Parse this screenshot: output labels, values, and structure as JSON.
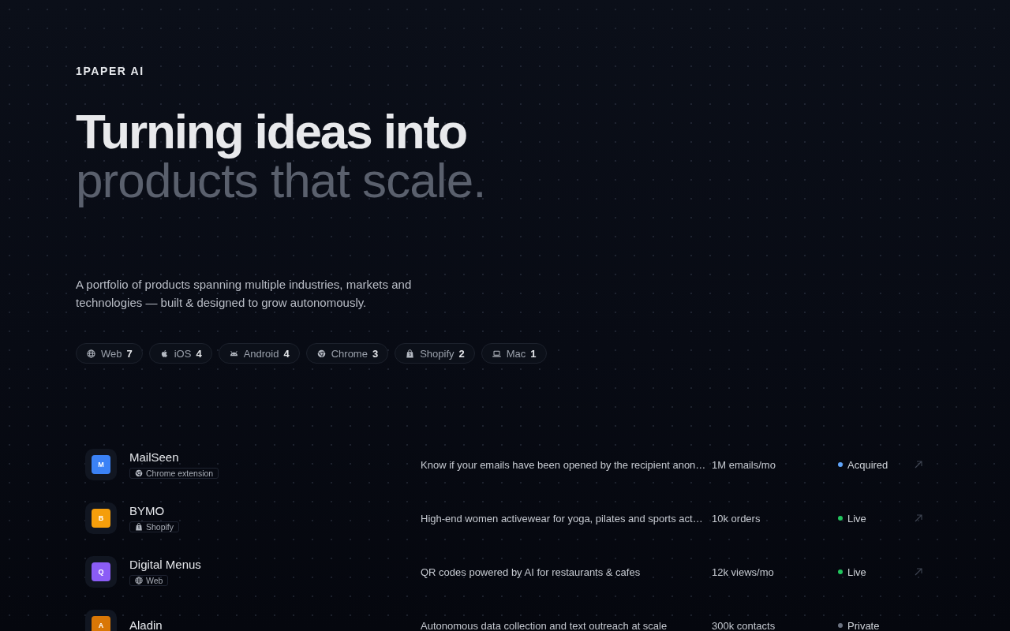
{
  "brand": "1PAPER AI",
  "headline": {
    "line_1": "Turning ideas into",
    "line_2": "products that scale."
  },
  "intro": "A portfolio of products spanning multiple industries, markets and technologies — built & designed to grow autonomously.",
  "platform_filters": [
    {
      "kind": "web",
      "label": "Web",
      "count": "7"
    },
    {
      "kind": "ios",
      "label": "iOS",
      "count": "4"
    },
    {
      "kind": "android",
      "label": "Android",
      "count": "4"
    },
    {
      "kind": "chrome",
      "label": "Chrome",
      "count": "3"
    },
    {
      "kind": "shopify",
      "label": "Shopify",
      "count": "2"
    },
    {
      "kind": "mac",
      "label": "Mac",
      "count": "1"
    }
  ],
  "products": [
    {
      "name": "MailSeen",
      "logo_letter": "M",
      "color": "#3b82f6",
      "platform": {
        "kind": "chrome",
        "label": "Chrome extension"
      },
      "description": "Know if your emails have been opened by the recipient anon…",
      "metric": "1M emails/mo",
      "status": {
        "label": "Acquired",
        "color": "#60a5fa"
      },
      "has_link": true
    },
    {
      "name": "BYMO",
      "logo_letter": "B",
      "color": "#f59e0b",
      "platform": {
        "kind": "shopify",
        "label": "Shopify"
      },
      "description": "High-end women activewear for yoga, pilates and sports act…",
      "metric": "10k orders",
      "status": {
        "label": "Live",
        "color": "#22c55e"
      },
      "has_link": true
    },
    {
      "name": "Digital Menus",
      "logo_letter": "Q",
      "color": "#8b5cf6",
      "platform": {
        "kind": "web",
        "label": "Web"
      },
      "description": "QR codes powered by AI for restaurants & cafes",
      "metric": "12k views/mo",
      "status": {
        "label": "Live",
        "color": "#22c55e"
      },
      "has_link": true
    },
    {
      "name": "Aladin",
      "logo_letter": "A",
      "color": "#d97706",
      "description": "Autonomous data collection and text outreach at scale",
      "metric": "300k contacts",
      "status": {
        "label": "Private",
        "color": "#6b7280"
      },
      "has_link": false
    }
  ]
}
